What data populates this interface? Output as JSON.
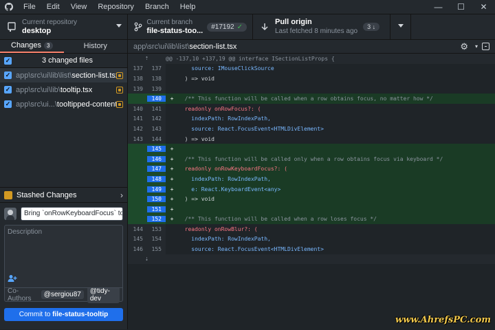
{
  "menu": [
    "File",
    "Edit",
    "View",
    "Repository",
    "Branch",
    "Help"
  ],
  "window_controls": [
    "minimize",
    "maximize",
    "close"
  ],
  "toolbar": {
    "repo_label": "Current repository",
    "repo_value": "desktop",
    "branch_label": "Current branch",
    "branch_value": "file-status-too...",
    "pr_number": "#17192",
    "pull_label": "Pull origin",
    "pull_sub": "Last fetched 8 minutes ago",
    "pull_count": "3"
  },
  "tabs": {
    "changes": "Changes",
    "changes_count": "3",
    "history": "History"
  },
  "changed_files_title": "3 changed files",
  "files": [
    {
      "dim": "app\\src\\ui\\lib\\list\\",
      "name": "section-list.tsx"
    },
    {
      "dim": "app\\src\\ui\\lib\\",
      "name": "tooltip.tsx"
    },
    {
      "dim": "app\\src\\ui...\\",
      "name": "tooltipped-content.tsx"
    }
  ],
  "stash_label": "Stashed Changes",
  "commit": {
    "summary_value": "Bring `onRowKeyboardFocus` to `Se",
    "description_placeholder": "Description",
    "coauthors_label": "Co-Authors",
    "coauthors": [
      "@sergiou87",
      "@tidy-dev"
    ],
    "button_prefix": "Commit to ",
    "button_branch": "file-status-tooltip"
  },
  "diff": {
    "path_dim": "app\\src\\ui\\lib\\list\\",
    "path_file": "section-list.tsx",
    "hunk": "@@ -137,10 +137,19 @@ interface ISectionListProps {",
    "lines": [
      {
        "old": "137",
        "new": "137",
        "type": "ctx",
        "code": "    source: IMouseClickSource"
      },
      {
        "old": "138",
        "new": "138",
        "type": "ctx",
        "code": "  ) => void"
      },
      {
        "old": "139",
        "new": "139",
        "type": "ctx",
        "code": ""
      },
      {
        "old": "",
        "new": "140",
        "type": "add",
        "code": "  /** This function will be called when a row obtains focus, no matter how */"
      },
      {
        "old": "140",
        "new": "141",
        "type": "ctx",
        "code": "  readonly onRowFocus?: ("
      },
      {
        "old": "141",
        "new": "142",
        "type": "ctx",
        "code": "    indexPath: RowIndexPath,"
      },
      {
        "old": "142",
        "new": "143",
        "type": "ctx",
        "code": "    source: React.FocusEvent<HTMLDivElement>"
      },
      {
        "old": "143",
        "new": "144",
        "type": "ctx",
        "code": "  ) => void"
      },
      {
        "old": "",
        "new": "145",
        "type": "add",
        "code": ""
      },
      {
        "old": "",
        "new": "146",
        "type": "add",
        "code": "  /** This function will be called only when a row obtains focus via keyboard */"
      },
      {
        "old": "",
        "new": "147",
        "type": "add",
        "code": "  readonly onRowKeyboardFocus?: ("
      },
      {
        "old": "",
        "new": "148",
        "type": "add",
        "code": "    indexPath: RowIndexPath,"
      },
      {
        "old": "",
        "new": "149",
        "type": "add",
        "code": "    e: React.KeyboardEvent<any>"
      },
      {
        "old": "",
        "new": "150",
        "type": "add",
        "code": "  ) => void"
      },
      {
        "old": "",
        "new": "151",
        "type": "add",
        "code": ""
      },
      {
        "old": "",
        "new": "152",
        "type": "add",
        "code": "  /** This function will be called when a row loses focus */"
      },
      {
        "old": "144",
        "new": "153",
        "type": "ctx",
        "code": "  readonly onRowBlur?: ("
      },
      {
        "old": "145",
        "new": "154",
        "type": "ctx",
        "code": "    indexPath: RowIndexPath,"
      },
      {
        "old": "146",
        "new": "155",
        "type": "ctx",
        "code": "    source: React.FocusEvent<HTMLDivElement>"
      }
    ]
  },
  "watermark": "www.AhrefsPC.com"
}
